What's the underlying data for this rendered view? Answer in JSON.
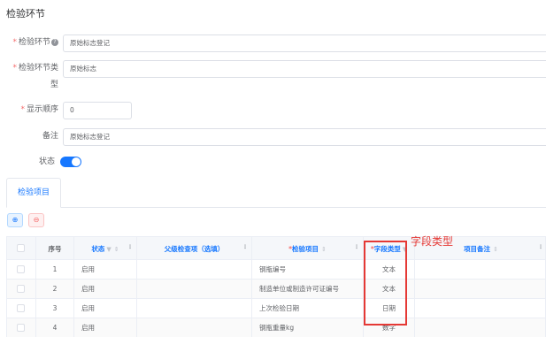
{
  "page": {
    "title": "检验环节"
  },
  "form": {
    "step_label": "检验环节",
    "step_value": "原始标志登记",
    "step_type_label_line1": "检验环节类",
    "step_type_label_line2": "型",
    "step_type_value": "原始标志",
    "order_label": "显示顺序",
    "order_value": "0",
    "remark_label": "备注",
    "remark_value": "原始标志登记",
    "status_label": "状态",
    "status_on": true,
    "required_mark": "*"
  },
  "tabs": [
    {
      "label": "检验项目",
      "active": true
    }
  ],
  "toolbar": {
    "add_glyph": "⊕",
    "delete_glyph": "⊖"
  },
  "table": {
    "columns": {
      "index": "序号",
      "status": "状态",
      "parent": "父级检查项（选填）",
      "item": "检验项目",
      "field_type": "字段类型",
      "remark": "项目备注"
    },
    "rows": [
      {
        "index": "1",
        "status": "启用",
        "parent": "",
        "item": "钢瓶编号",
        "field_type": "文本",
        "remark": ""
      },
      {
        "index": "2",
        "status": "启用",
        "parent": "",
        "item": "制造单位或制造许可证编号",
        "field_type": "文本",
        "remark": ""
      },
      {
        "index": "3",
        "status": "启用",
        "parent": "",
        "item": "上次检验日期",
        "field_type": "日期",
        "remark": ""
      },
      {
        "index": "4",
        "status": "启用",
        "parent": "",
        "item": "钢瓶重量kg",
        "field_type": "数字",
        "remark": ""
      }
    ]
  },
  "annotation": {
    "text": "字段类型",
    "color": "#e53935"
  },
  "colors": {
    "accent": "#1677ff",
    "danger": "#f56c6c",
    "annotation": "#e53935"
  }
}
